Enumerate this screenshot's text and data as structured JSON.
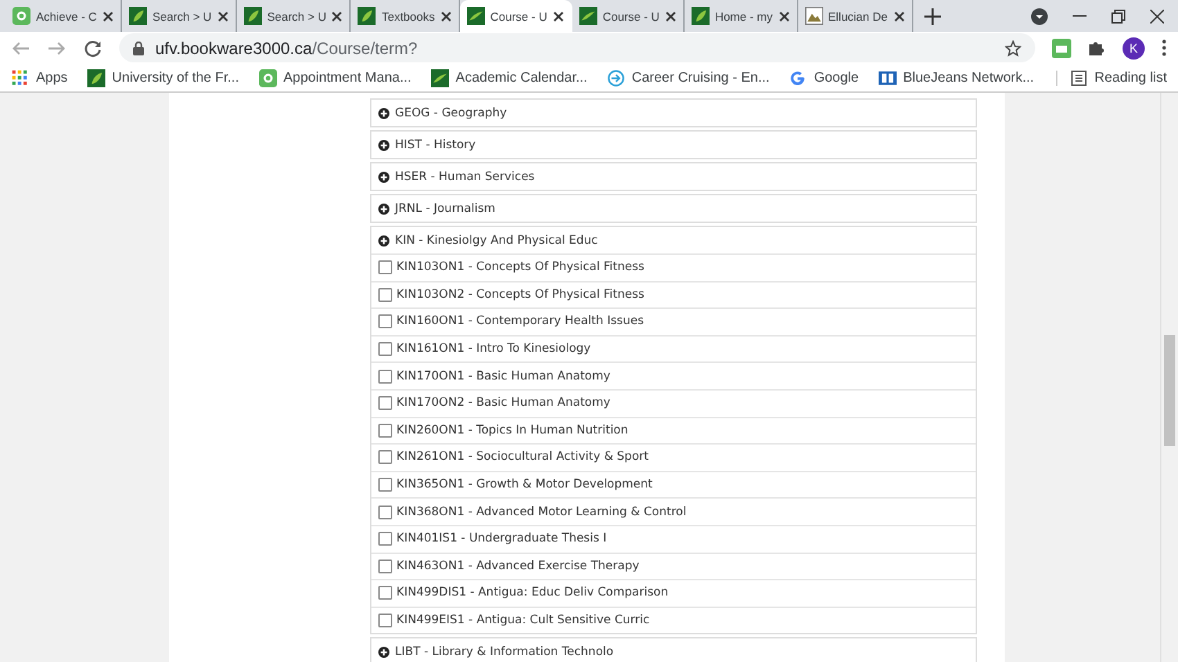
{
  "browser": {
    "tabs": [
      {
        "title": "Achieve - C",
        "kind": "badge",
        "selected": false
      },
      {
        "title": "Search > U",
        "kind": "leaf",
        "selected": false
      },
      {
        "title": "Search > U",
        "kind": "leaf",
        "selected": false
      },
      {
        "title": "Textbooks",
        "kind": "leaf",
        "selected": false
      },
      {
        "title": "Course - U",
        "kind": "swoosh",
        "selected": true
      },
      {
        "title": "Course - U",
        "kind": "swoosh",
        "selected": false
      },
      {
        "title": "Home - my",
        "kind": "leaf",
        "selected": false
      },
      {
        "title": "Ellucian De",
        "kind": "image",
        "selected": false
      }
    ],
    "url": {
      "host": "ufv.bookware3000.ca",
      "path": "/Course/term?"
    },
    "profile": "K",
    "bookmarks": [
      {
        "label": "Apps",
        "kind": "apps"
      },
      {
        "label": "University of the Fr...",
        "kind": "leaf"
      },
      {
        "label": "Appointment Mana...",
        "kind": "badge"
      },
      {
        "label": "Academic Calendar...",
        "kind": "swoosh"
      },
      {
        "label": "Career Cruising - En...",
        "kind": "arrow"
      },
      {
        "label": "Google",
        "kind": "google"
      },
      {
        "label": "BlueJeans Network...",
        "kind": "bj"
      }
    ],
    "reading_list": "Reading list"
  },
  "subjects": [
    {
      "label": "GEOG - Geography"
    },
    {
      "label": "HIST - History"
    },
    {
      "label": "HSER - Human Services"
    },
    {
      "label": "JRNL - Journalism"
    },
    {
      "label": "KIN - Kinesiolgy And Physical Educ",
      "children": [
        {
          "label": "KIN103ON1 - Concepts Of Physical Fitness",
          "checked": false
        },
        {
          "label": "KIN103ON2 - Concepts Of Physical Fitness",
          "checked": false
        },
        {
          "label": "KIN160ON1 - Contemporary Health Issues",
          "checked": false
        },
        {
          "label": "KIN161ON1 - Intro To Kinesiology",
          "checked": false
        },
        {
          "label": "KIN170ON1 - Basic Human Anatomy",
          "checked": false
        },
        {
          "label": "KIN170ON2 - Basic Human Anatomy",
          "checked": false
        },
        {
          "label": "KIN260ON1 - Topics In Human Nutrition",
          "checked": false
        },
        {
          "label": "KIN261ON1 - Sociocultural Activity & Sport",
          "checked": false
        },
        {
          "label": "KIN365ON1 - Growth & Motor Development",
          "checked": false
        },
        {
          "label": "KIN368ON1 - Advanced Motor Learning & Control",
          "checked": false
        },
        {
          "label": "KIN401IS1 - Undergraduate Thesis I",
          "checked": false
        },
        {
          "label": "KIN463ON1 - Advanced Exercise Therapy",
          "checked": false
        },
        {
          "label": "KIN499DIS1 - Antigua: Educ Deliv Comparison",
          "checked": false
        },
        {
          "label": "KIN499EIS1 - Antigua: Cult Sensitive Curric",
          "checked": false
        }
      ]
    },
    {
      "label": "LIBT - Library & Information Technolo"
    }
  ]
}
